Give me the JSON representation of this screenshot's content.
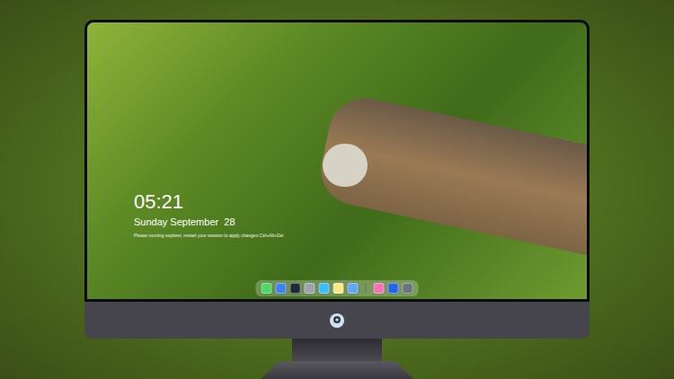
{
  "lock_screen": {
    "time": "05:21",
    "date": "Sunday September  28",
    "notice": "Please running explorer, restart your session to apply changes  Ctrl+Alt+Del"
  },
  "dock": {
    "items": [
      {
        "kind": "app",
        "color": "#4cd964"
      },
      {
        "kind": "app",
        "color": "#3b82f6"
      },
      {
        "kind": "app",
        "color": "#1f2937"
      },
      {
        "kind": "app",
        "color": "#9ca3af"
      },
      {
        "kind": "app",
        "color": "#38bdf8"
      },
      {
        "kind": "app",
        "color": "#fde68a"
      },
      {
        "kind": "app",
        "color": "#60a5fa"
      },
      {
        "kind": "separator",
        "color": "#6b7280"
      },
      {
        "kind": "app",
        "color": "#f472b6"
      },
      {
        "kind": "app",
        "color": "#2563eb"
      },
      {
        "kind": "app",
        "color": "#6b7280"
      }
    ]
  }
}
